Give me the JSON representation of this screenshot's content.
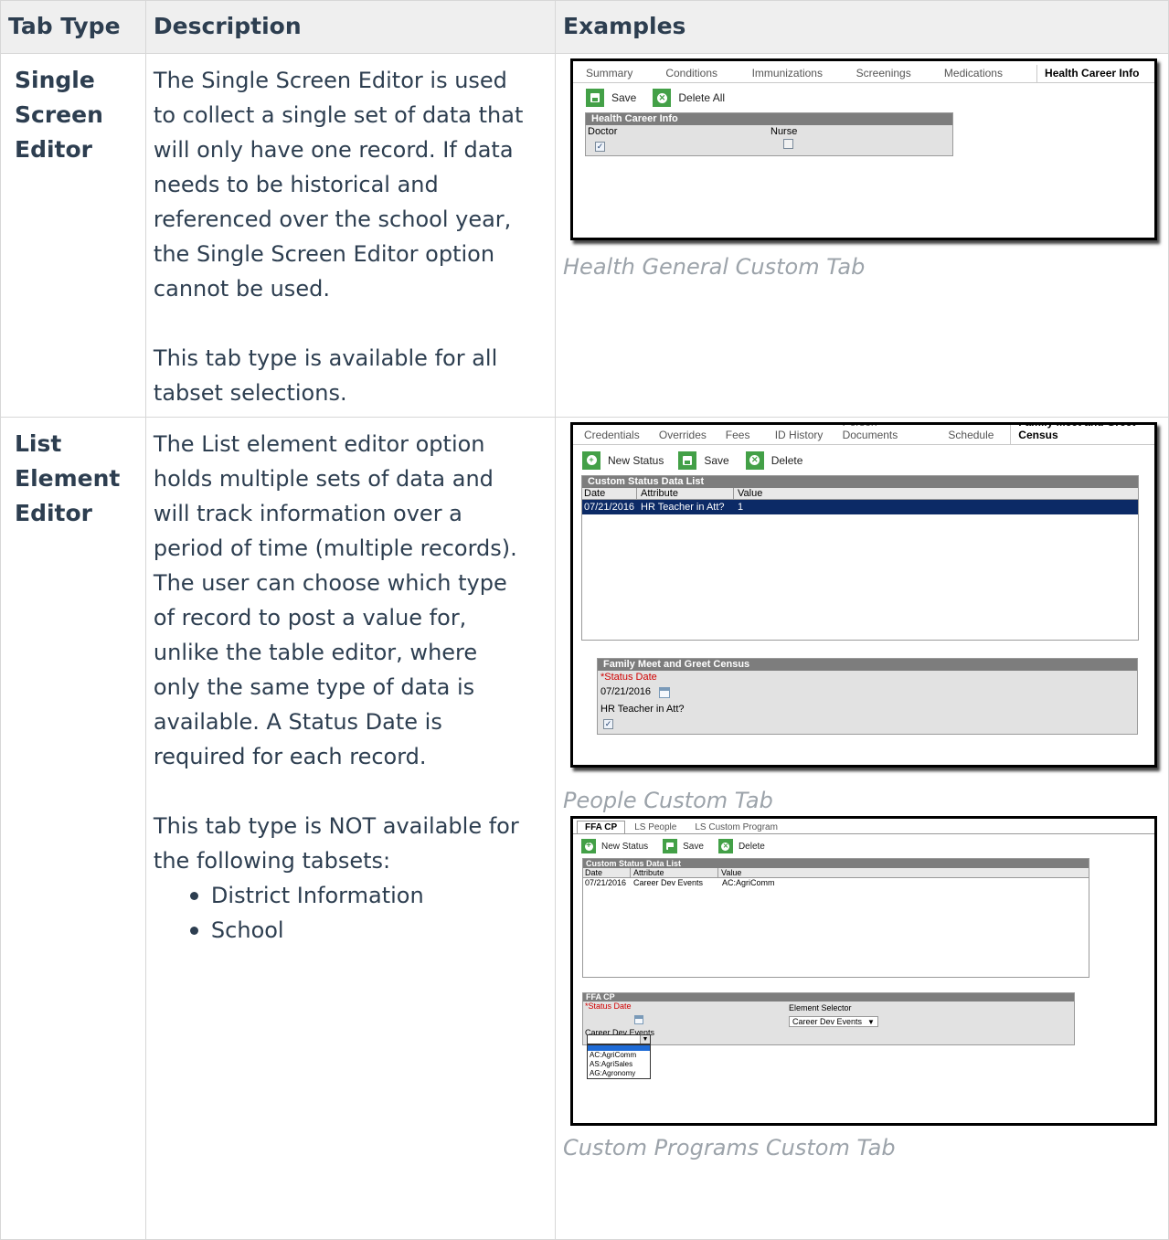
{
  "table": {
    "headers": [
      "Tab Type",
      "Description",
      "Examples"
    ],
    "rows": [
      {
        "type_lines": [
          "Single",
          "Screen",
          "Editor"
        ],
        "para1_lines": [
          "The Single Screen Editor is used",
          "to collect a single set of data that",
          "will only have one record. If data",
          "needs to be historical and",
          "referenced over the school year,",
          "the Single Screen Editor option",
          "cannot be used."
        ],
        "para2_lines": [
          "This tab type is available for all",
          "tabset selections."
        ],
        "captions": [
          "Health General Custom Tab"
        ]
      },
      {
        "type_lines": [
          "List",
          "Element",
          "Editor"
        ],
        "para1_lines": [
          "The List element editor option",
          "holds multiple sets of data  and",
          "will track information over a",
          "period of time (multiple records).",
          "The user can choose which type",
          "of record to post a value for,",
          "unlike the table editor, where",
          "only the same type of data is",
          "available. A Status Date is",
          "required for each record."
        ],
        "para2_lines": [
          "This tab type is NOT available for",
          "the following tabsets:"
        ],
        "bullets": [
          "District Information",
          "School"
        ],
        "captions": [
          "People Custom Tab",
          "Custom Programs Custom Tab"
        ]
      }
    ]
  },
  "shot1": {
    "tabs": [
      "Summary",
      "Conditions",
      "Immunizations",
      "Screenings",
      "Medications",
      "Health Career Info"
    ],
    "buttons": [
      "Save",
      "Delete All"
    ],
    "panel_title": "Health Career Info",
    "field1": "Doctor",
    "field2": "Nurse",
    "check": "✓"
  },
  "shot2": {
    "tabs": [
      "Credentials",
      "Overrides",
      "Fees",
      "ID History",
      "Person Documents",
      "Schedule",
      "Family Meet and Greet Census"
    ],
    "buttons": [
      "New Status",
      "Save",
      "Delete"
    ],
    "list_title": "Custom Status Data List",
    "columns": [
      "Date",
      "Attribute",
      "Value"
    ],
    "row": [
      "07/21/2016",
      "HR Teacher in Att?",
      "1"
    ],
    "panel_title": "Family Meet and Greet Census",
    "status_label": "*Status Date",
    "status_value": "07/21/2016",
    "field_label": "HR Teacher in Att?",
    "check": "✓"
  },
  "shot3": {
    "tabs": [
      "FFA CP",
      "LS People",
      "LS Custom Program"
    ],
    "buttons": [
      "New Status",
      "Save",
      "Delete"
    ],
    "list_title": "Custom Status Data List",
    "columns": [
      "Date",
      "Attribute",
      "Value"
    ],
    "row": [
      "07/21/2016",
      "Career Dev Events",
      "AC:AgriComm"
    ],
    "panel_title": "FFA CP",
    "status_label": "*Status Date",
    "element_selector_label": "Element Selector",
    "element_selector_value": "Career Dev Events",
    "career_label": "Career Dev Events",
    "options": [
      "AC:AgriComm",
      "AS:AgriSales",
      "AG:Agronomy"
    ]
  }
}
